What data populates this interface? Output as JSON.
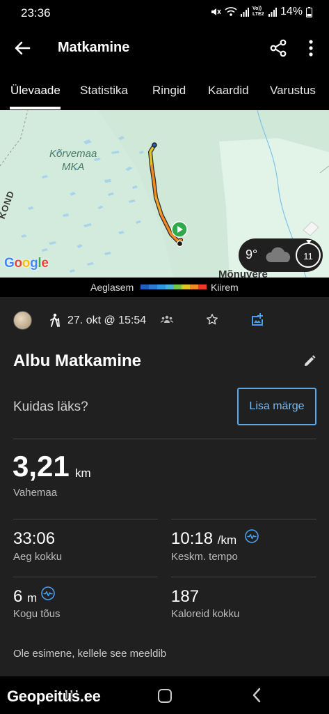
{
  "status_bar": {
    "time": "23:36",
    "network_label": "Vo)) LTE2",
    "battery": "14%"
  },
  "app_bar": {
    "title": "Matkamine",
    "icons": [
      "back-arrow-icon",
      "share-icon",
      "more-vert-icon"
    ]
  },
  "tabs": [
    {
      "label": "Ülevaade",
      "active": true
    },
    {
      "label": "Statistika",
      "active": false
    },
    {
      "label": "Ringid",
      "active": false
    },
    {
      "label": "Kaardid",
      "active": false
    },
    {
      "label": "Varustus",
      "active": false
    }
  ],
  "map": {
    "area_label": "Kõrvemaa MKA",
    "area_label_line1": "Kõrvemaa",
    "area_label_line2": "MKA",
    "edge_label": "KOND",
    "town_label": "Mõnuvere",
    "attribution": "Google",
    "weather": {
      "temperature": "9°",
      "wind": "11",
      "icon": "cloud-icon"
    }
  },
  "speed_legend": {
    "slow_label": "Aeglasem",
    "fast_label": "Kiirem",
    "colors": [
      "#1f5fbf",
      "#2a7ad8",
      "#2c9ae0",
      "#44b3d6",
      "#7cc242",
      "#e0c42a",
      "#f28a22",
      "#e83a2a"
    ]
  },
  "activity": {
    "activity_icon": "hiking-icon",
    "date": "27. okt @ 15:54",
    "title": "Albu Matkamine",
    "prompt": "Kuidas läks?",
    "add_note_label": "Lisa märge",
    "distance": {
      "value": "3,21",
      "unit": "km",
      "label": "Vahemaa"
    },
    "time": {
      "value": "33:06",
      "label": "Aeg kokku"
    },
    "pace": {
      "value": "10:18",
      "unit": "/km",
      "label": "Keskm. tempo"
    },
    "ascent": {
      "value": "6",
      "unit": "m",
      "label": "Kogu tõus"
    },
    "calories": {
      "value": "187",
      "label": "Kaloreid kokku"
    },
    "likes_text": "Ole esimene, kellele see meeldib"
  },
  "watermark": "Geopeitus.ee"
}
